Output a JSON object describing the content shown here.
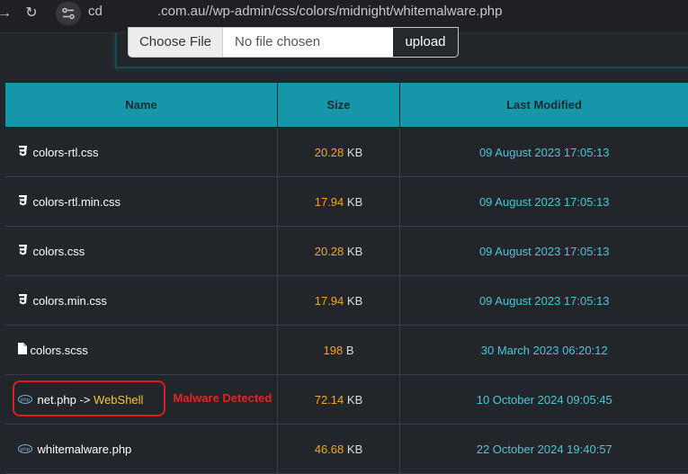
{
  "browser": {
    "url_prefix": "cd",
    "url": ".com.au//wp-admin/css/colors/midnight/whitemalware.php"
  },
  "upload": {
    "choose_label": "Choose File",
    "no_file_label": "No file chosen",
    "upload_label": "upload"
  },
  "table": {
    "headers": {
      "name": "Name",
      "size": "Size",
      "modified": "Last Modified"
    },
    "rows": [
      {
        "name": "colors-rtl.css",
        "icon": "css3-icon",
        "size": "20.28",
        "unit": "KB",
        "modified": "09 August 2023 17:05:13"
      },
      {
        "name": "colors-rtl.min.css",
        "icon": "css3-icon",
        "size": "17.94",
        "unit": "KB",
        "modified": "09 August 2023 17:05:13"
      },
      {
        "name": "colors.css",
        "icon": "css3-icon",
        "size": "20.28",
        "unit": "KB",
        "modified": "09 August 2023 17:05:13"
      },
      {
        "name": "colors.min.css",
        "icon": "css3-icon",
        "size": "17.94",
        "unit": "KB",
        "modified": "09 August 2023 17:05:13"
      },
      {
        "name": "colors.scss",
        "icon": "file-icon",
        "size": "198",
        "unit": "B",
        "modified": "30 March 2023 06:20:12"
      },
      {
        "name": "net.php -> ",
        "tag": "WebShell",
        "icon": "php-icon",
        "size": "72.14",
        "unit": "KB",
        "modified": "10 October 2024 09:05:45",
        "alert": "Malware Detected"
      },
      {
        "name": "whitemalware.php",
        "icon": "php-icon",
        "size": "46.68",
        "unit": "KB",
        "modified": "22 October 2024 19:40:57"
      }
    ]
  },
  "colors": {
    "header_bg": "#1697a9",
    "size_number": "#f5a623",
    "date_text": "#4cc6d6",
    "alert": "#e52424"
  }
}
